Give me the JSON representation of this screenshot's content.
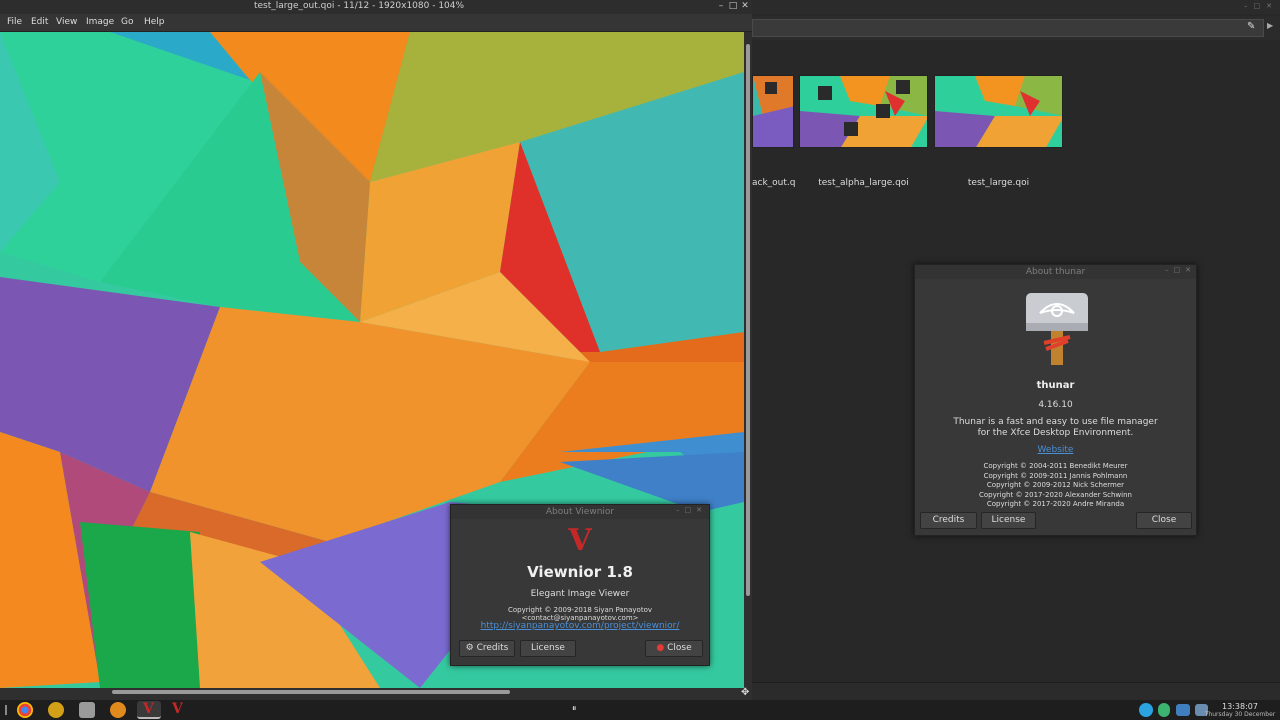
{
  "viewnior": {
    "title": "test_large_out.qoi - 11/12 - 1920x1080 - 104%",
    "menu": [
      "File",
      "Edit",
      "View",
      "Image",
      "Go",
      "Help"
    ],
    "window_buttons": [
      "–",
      "□",
      "✕"
    ]
  },
  "about_viewnior": {
    "title": "About Viewnior",
    "logo_letter": "V",
    "app_name": "Viewnior 1.8",
    "tagline": "Elegant Image Viewer",
    "copyright": "Copyright © 2009-2018 Siyan Panayotov <contact@siyanpanayotov.com>",
    "link": "http://siyanpanayotov.com/project/viewnior/",
    "buttons": {
      "credits": "Credits",
      "license": "License",
      "close": "Close"
    }
  },
  "thunar": {
    "files": [
      {
        "name": "ack_out.q"
      },
      {
        "name": "test_alpha_large.qoi"
      },
      {
        "name": "test_large.qoi"
      }
    ]
  },
  "about_thunar": {
    "title": "About thunar",
    "app_name": "thunar",
    "version": "4.16.10",
    "description_line1": "Thunar is a fast and easy to use file manager",
    "description_line2": "for the Xfce Desktop Environment.",
    "website": "Website",
    "copyrights": [
      "Copyright © 2004-2011 Benedikt Meurer",
      "Copyright © 2009-2011 Jannis Pohlmann",
      "Copyright © 2009-2012 Nick Schermer",
      "Copyright © 2017-2020 Alexander Schwinn",
      "Copyright © 2017-2020 Andre Miranda"
    ],
    "buttons": {
      "credits": "Credits",
      "license": "License",
      "close": "Close"
    }
  },
  "taskbar": {
    "pause_glyph": "⏸",
    "clock_time": "13:38:07",
    "clock_date": "Thursday 30 December"
  },
  "colors": {
    "viewnior_red": "#c62828",
    "link_blue": "#4a90d9",
    "accent_orange": "#f5901e"
  }
}
